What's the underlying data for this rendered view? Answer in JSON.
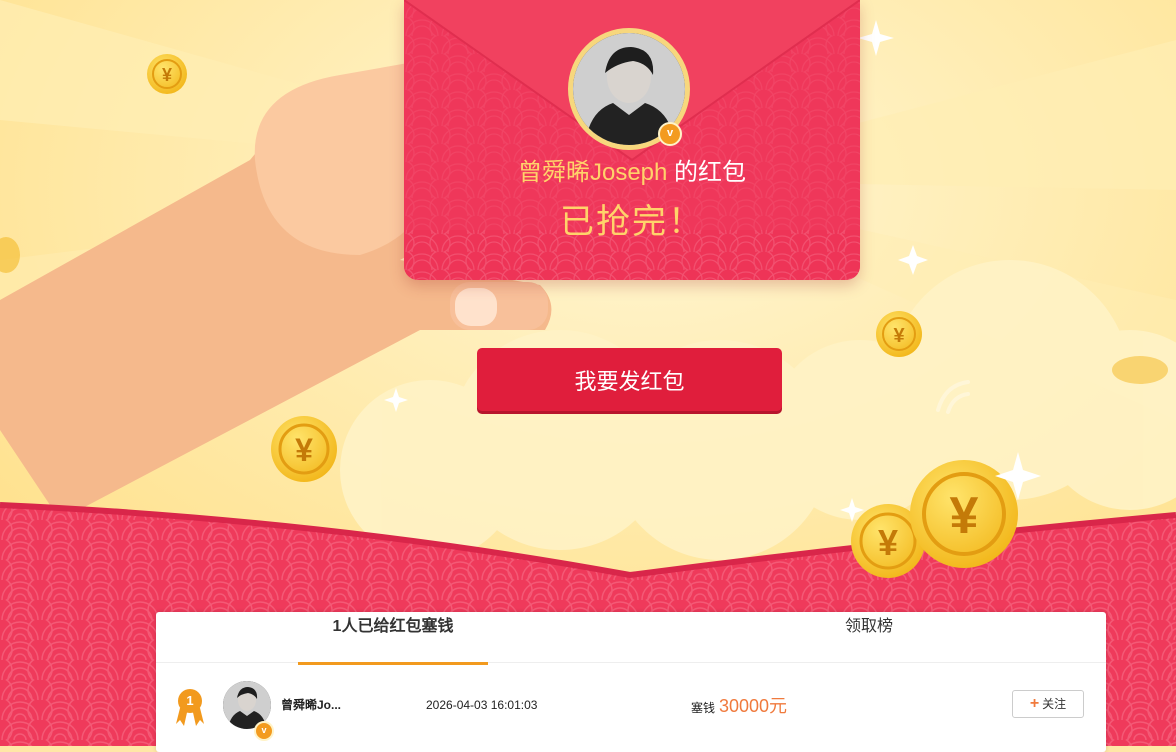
{
  "envelope": {
    "sender_name": "曾舜晞Joseph",
    "suffix": "的红包",
    "status": "已抢完！",
    "verified_badge": "v"
  },
  "actions": {
    "send_label": "我要发红包"
  },
  "tabs": [
    {
      "label": "1人已给红包塞钱",
      "active": true
    },
    {
      "label": "领取榜",
      "active": false
    }
  ],
  "records": [
    {
      "rank": "1",
      "name": "曾舜晞Jo...",
      "time": "2026-04-03 16:01:03",
      "amount_label": "塞钱",
      "amount": "30000元",
      "follow_label": "关注"
    }
  ],
  "colors": {
    "envelope_red": "#ef3a5b",
    "button_red": "#e01e3c",
    "gold": "#ffd36a",
    "accent_orange": "#f29a1e",
    "background_yellow": "#ffe7a6"
  }
}
